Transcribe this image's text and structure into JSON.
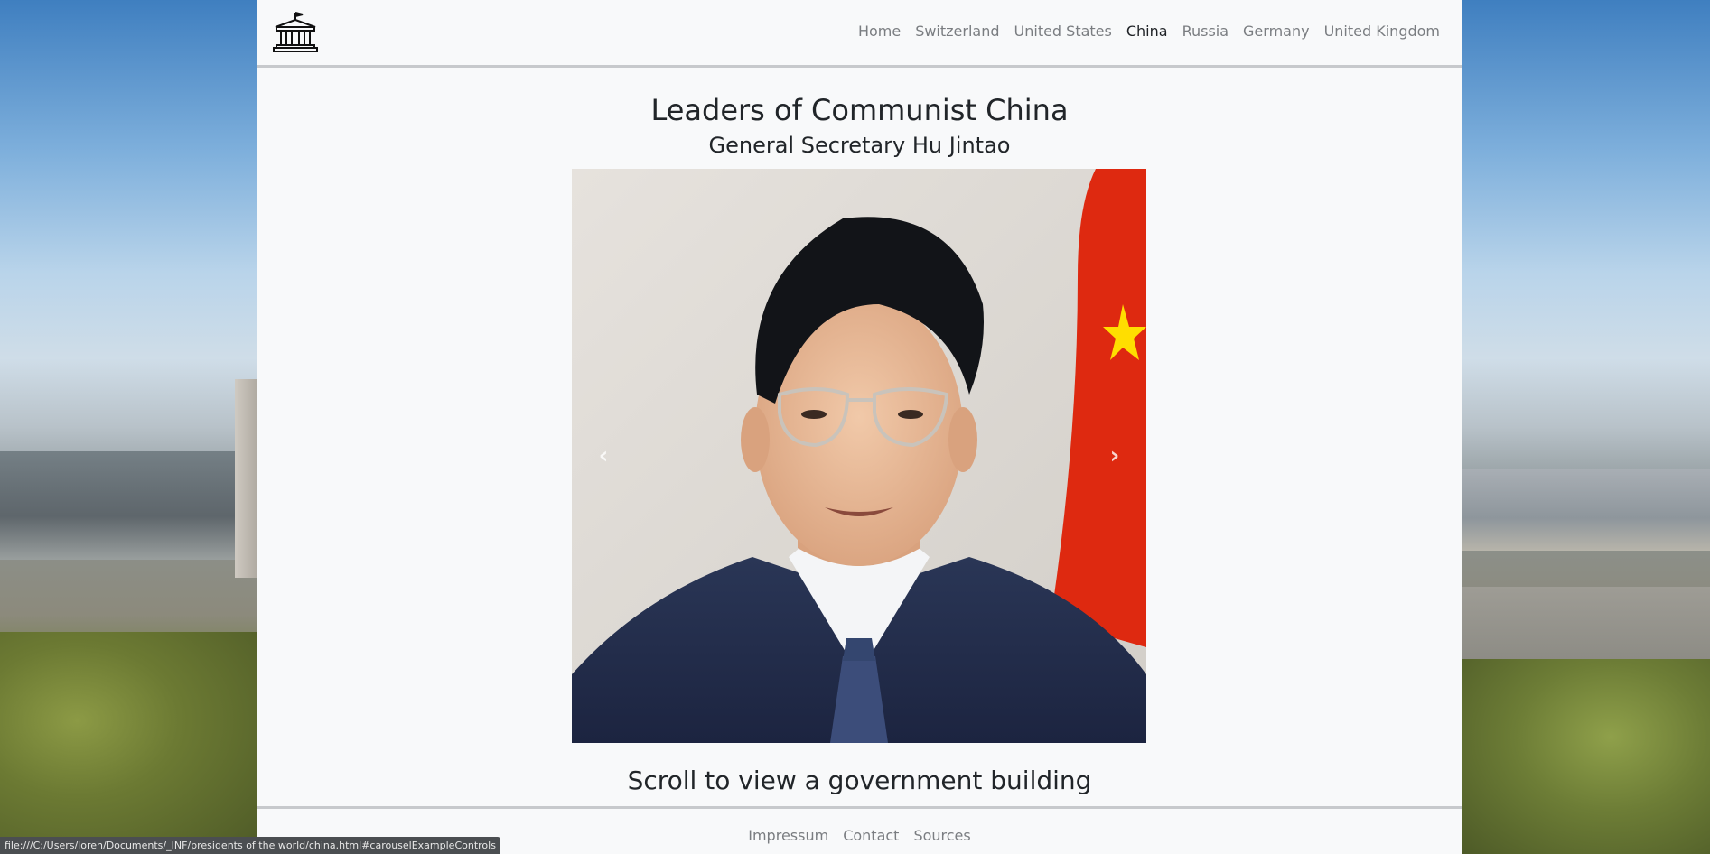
{
  "nav": {
    "links": [
      "Home",
      "Switzerland",
      "United States",
      "China",
      "Russia",
      "Germany",
      "United Kingdom"
    ],
    "active": "China"
  },
  "main": {
    "title": "Leaders of Communist China",
    "subtitle": "General Secretary Hu Jintao",
    "scroll_hint": "Scroll to view a government building"
  },
  "carousel": {
    "prev_icon": "chevron-left-icon",
    "next_icon": "chevron-right-icon",
    "prev_glyph": "‹",
    "next_glyph": "›"
  },
  "footer": {
    "links": [
      "Impressum",
      "Contact",
      "Sources"
    ]
  },
  "statusbar": {
    "url": "file:///C:/Users/loren/Documents/_INF/presidents of the world/china.html#carouselExampleControls"
  },
  "colors": {
    "page_bg": "#f8f9fa",
    "nav_text": "#7a7d81",
    "nav_active": "#1f2226",
    "flag_red": "#de2910",
    "flag_star": "#ffde00"
  }
}
